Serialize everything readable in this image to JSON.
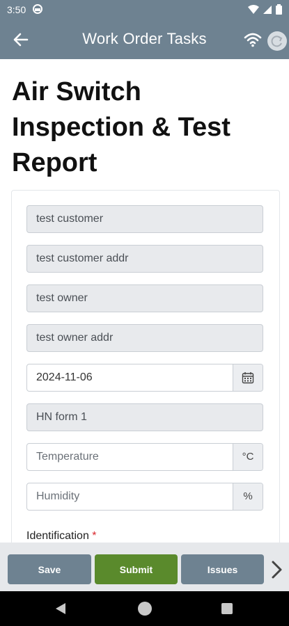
{
  "status_bar": {
    "time": "3:50"
  },
  "app_bar": {
    "title": "Work Order Tasks"
  },
  "report": {
    "title": "Air Switch Inspection & Test Report"
  },
  "form": {
    "customer": "test customer",
    "customer_addr": "test customer addr",
    "owner": "test owner",
    "owner_addr": "test owner addr",
    "date": "2024-11-06",
    "form_name": "HN form 1",
    "temperature_placeholder": "Temperature",
    "temperature_unit": "°C",
    "humidity_placeholder": "Humidity",
    "humidity_unit": "%",
    "identification_label": "Identification",
    "required_marker": "*"
  },
  "actions": {
    "save": "Save",
    "submit": "Submit",
    "issues": "Issues"
  },
  "colors": {
    "app_bar": "#6e8291",
    "submit": "#5a8a2c",
    "required": "#d9262c"
  },
  "icons": [
    "back-arrow-icon",
    "wifi-icon",
    "sync-icon",
    "calendar-icon",
    "chevron-right-icon"
  ]
}
